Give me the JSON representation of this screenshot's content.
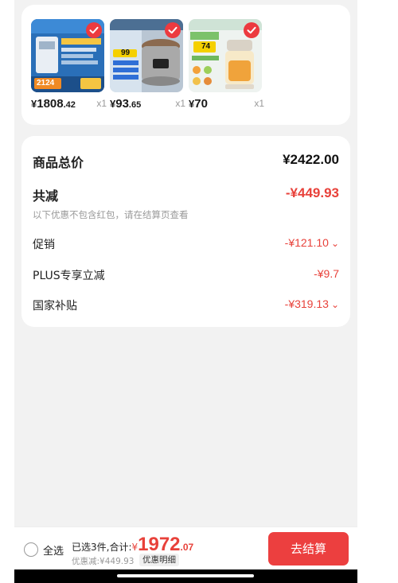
{
  "products": [
    {
      "price_currency": "¥",
      "price_int": "1808",
      "price_dec": ".42",
      "qty": "x1",
      "thumb_icon": "water-heater-product-image",
      "badge": "2124"
    },
    {
      "price_currency": "¥",
      "price_int": "93",
      "price_dec": ".65",
      "qty": "x1",
      "thumb_icon": "pressure-cooker-product-image",
      "badge": "99"
    },
    {
      "price_currency": "¥",
      "price_int": "70",
      "price_dec": "",
      "qty": "x1",
      "thumb_icon": "food-processor-product-image",
      "badge": "74"
    }
  ],
  "summary": {
    "total_label": "商品总价",
    "total_value": "¥2422.00",
    "reduce_label": "共减",
    "reduce_value": "-¥449.93",
    "note": "以下优惠不包含红包，请在结算页查看",
    "promo_label": "促销",
    "promo_value": "-¥121.10",
    "plus_label": "PLUS专享立减",
    "plus_value": "-¥9.7",
    "subsidy_label": "国家补贴",
    "subsidy_value": "-¥319.13"
  },
  "bottom": {
    "select_all": "全选",
    "selected_text": "已选3件,合计:",
    "total_currency": "¥",
    "total_int": "1972",
    "total_dec": ".07",
    "discount_text": "优惠减:¥449.93",
    "detail_label": "优惠明细",
    "checkout_label": "去结算"
  },
  "colors": {
    "accent": "#ec3f3f",
    "price_red": "#e8413a",
    "background": "#f2f2f2"
  }
}
